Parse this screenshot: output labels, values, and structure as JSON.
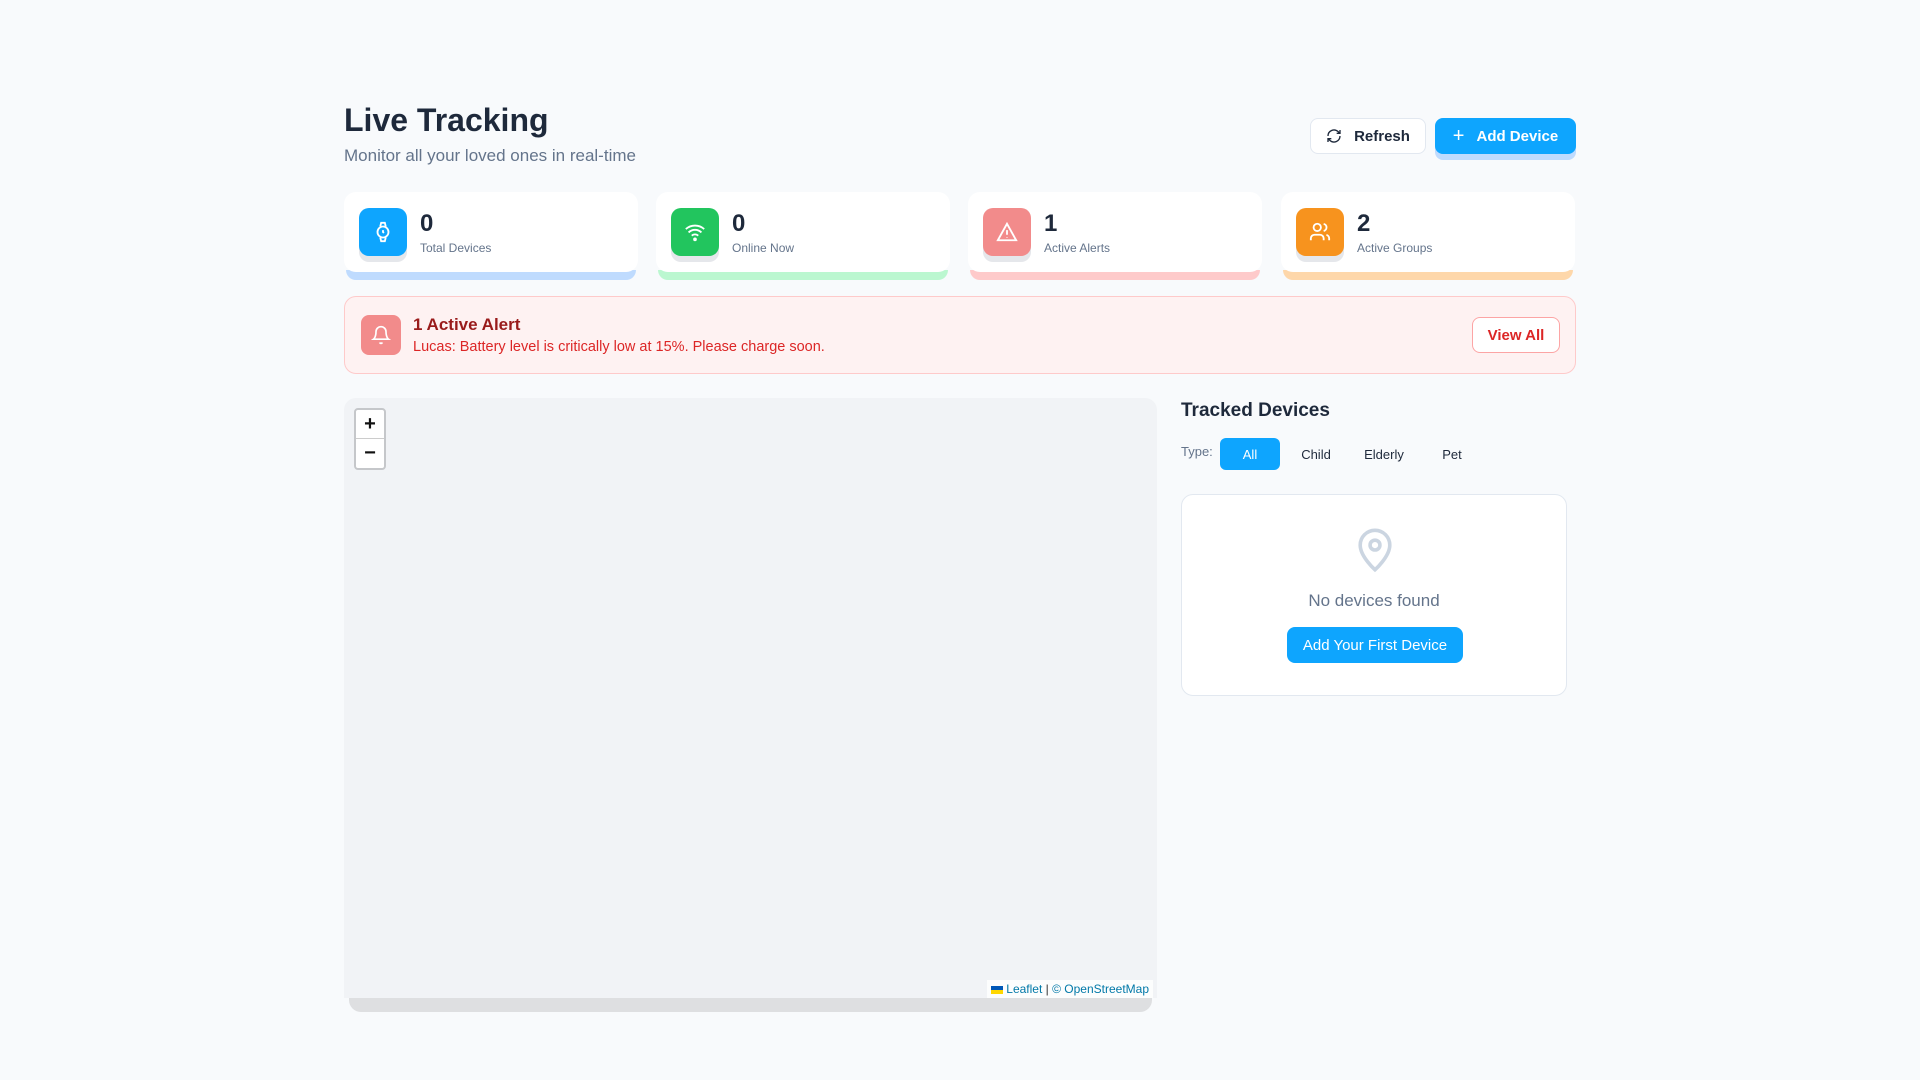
{
  "header": {
    "title": "Live Tracking",
    "subtitle": "Monitor all your loved ones in real-time",
    "refresh_label": "Refresh",
    "add_device_label": "Add Device"
  },
  "stats": [
    {
      "value": "0",
      "label": "Total Devices",
      "icon": "watch-icon",
      "color": "#0ea5fe",
      "bar": "#bfdbfe"
    },
    {
      "value": "0",
      "label": "Online Now",
      "icon": "wifi-icon",
      "color": "#22c55e",
      "bar": "#bbf7d0"
    },
    {
      "value": "1",
      "label": "Active Alerts",
      "icon": "warning-icon",
      "color": "#f28b8b",
      "bar": "#fecaca"
    },
    {
      "value": "2",
      "label": "Active Groups",
      "icon": "users-icon",
      "color": "#f7931e",
      "bar": "#fed7aa"
    }
  ],
  "alert": {
    "title": "1 Active Alert",
    "message": "Lucas: Battery level is critically low at 15%. Please charge soon.",
    "view_all": "View All"
  },
  "map": {
    "zoom_in": "+",
    "zoom_out": "−",
    "attribution_leaflet": "Leaflet",
    "attribution_sep": "|",
    "attribution_osm": "© OpenStreetMap"
  },
  "devices": {
    "title": "Tracked Devices",
    "type_label": "Type:",
    "filters": [
      "All",
      "Child",
      "Elderly",
      "Pet"
    ],
    "selected": "All",
    "empty_text": "No devices found",
    "add_first": "Add Your First Device"
  }
}
